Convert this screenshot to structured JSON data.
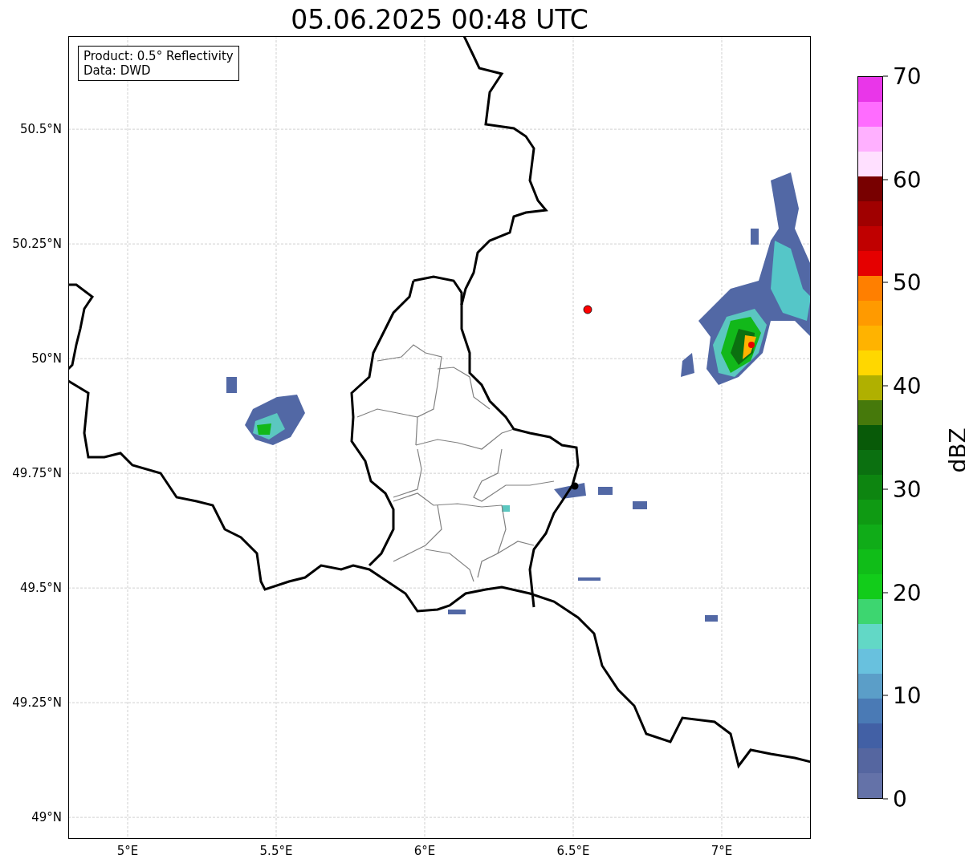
{
  "title": "05.06.2025 00:48 UTC",
  "info_box": [
    "Product: 0.5° Reflectivity",
    "Data: DWD"
  ],
  "map": {
    "x_ticks": [
      "5°E",
      "5.5°E",
      "6°E",
      "6.5°E",
      "7°E"
    ],
    "y_ticks": [
      "50.5°N",
      "50.25°N",
      "50°N",
      "49.75°N",
      "49.5°N",
      "49.25°N",
      "49°N"
    ]
  },
  "colorbar": {
    "label": "dBZ",
    "ticks": [
      "70",
      "60",
      "50",
      "40",
      "30",
      "20",
      "10",
      "0"
    ]
  }
}
